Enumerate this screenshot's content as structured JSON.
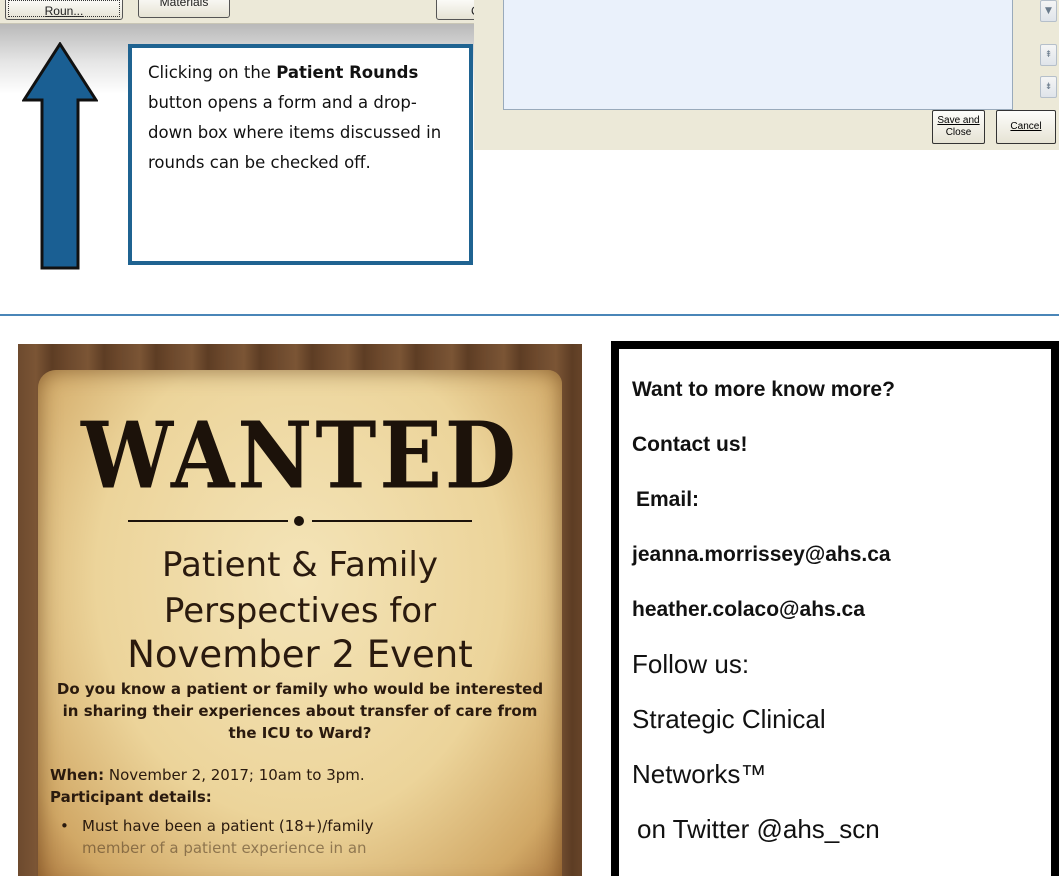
{
  "toolbar": {
    "rounds_button_label": "Roun...",
    "materials_button_label": "Materials",
    "close_button_label": "Clo"
  },
  "callout": {
    "text_1": "Clicking on the ",
    "bold_1": "Patient Rounds",
    "text_2": " button opens a form and a drop-down box where items discussed in rounds can be checked off."
  },
  "dialog": {
    "save_label_line1": "Save and",
    "save_label_line2": "Close",
    "cancel_label": "Cancel",
    "scroll_down_glyph": "▼",
    "scroll_top_glyph": "⇞",
    "scroll_bottom_glyph": "⇟"
  },
  "poster": {
    "wanted": "WANTED",
    "heading_1": "Patient & Family",
    "heading_2": "Perspectives for",
    "heading_3": "November 2 Event",
    "question": "Do you know a patient or family who would be interested in sharing their experiences about transfer of care from the ICU to Ward?",
    "when_label": "When:",
    "when_value": " November 2, 2017; 10am to 3pm.",
    "participant_label": "Participant details:",
    "bullet_1": "Must have been a patient (18+)/family",
    "bullet_1_cont": "member of a patient experience in an"
  },
  "contact": {
    "heading": "Want to more know more?",
    "contact_us": "Contact us!",
    "email_label": "Email:",
    "email_1": "jeanna.morrissey@ahs.ca",
    "email_2": "heather.colaco@ahs.ca",
    "follow": "Follow us:",
    "org_1": "Strategic Clinical",
    "org_2": "Networks™",
    "twitter": "on Twitter @ahs_scn"
  },
  "colors": {
    "arrow_fill": "#1a5f93",
    "callout_border": "#1f6391",
    "divider": "#4a86b8",
    "contact_border": "#000000"
  }
}
